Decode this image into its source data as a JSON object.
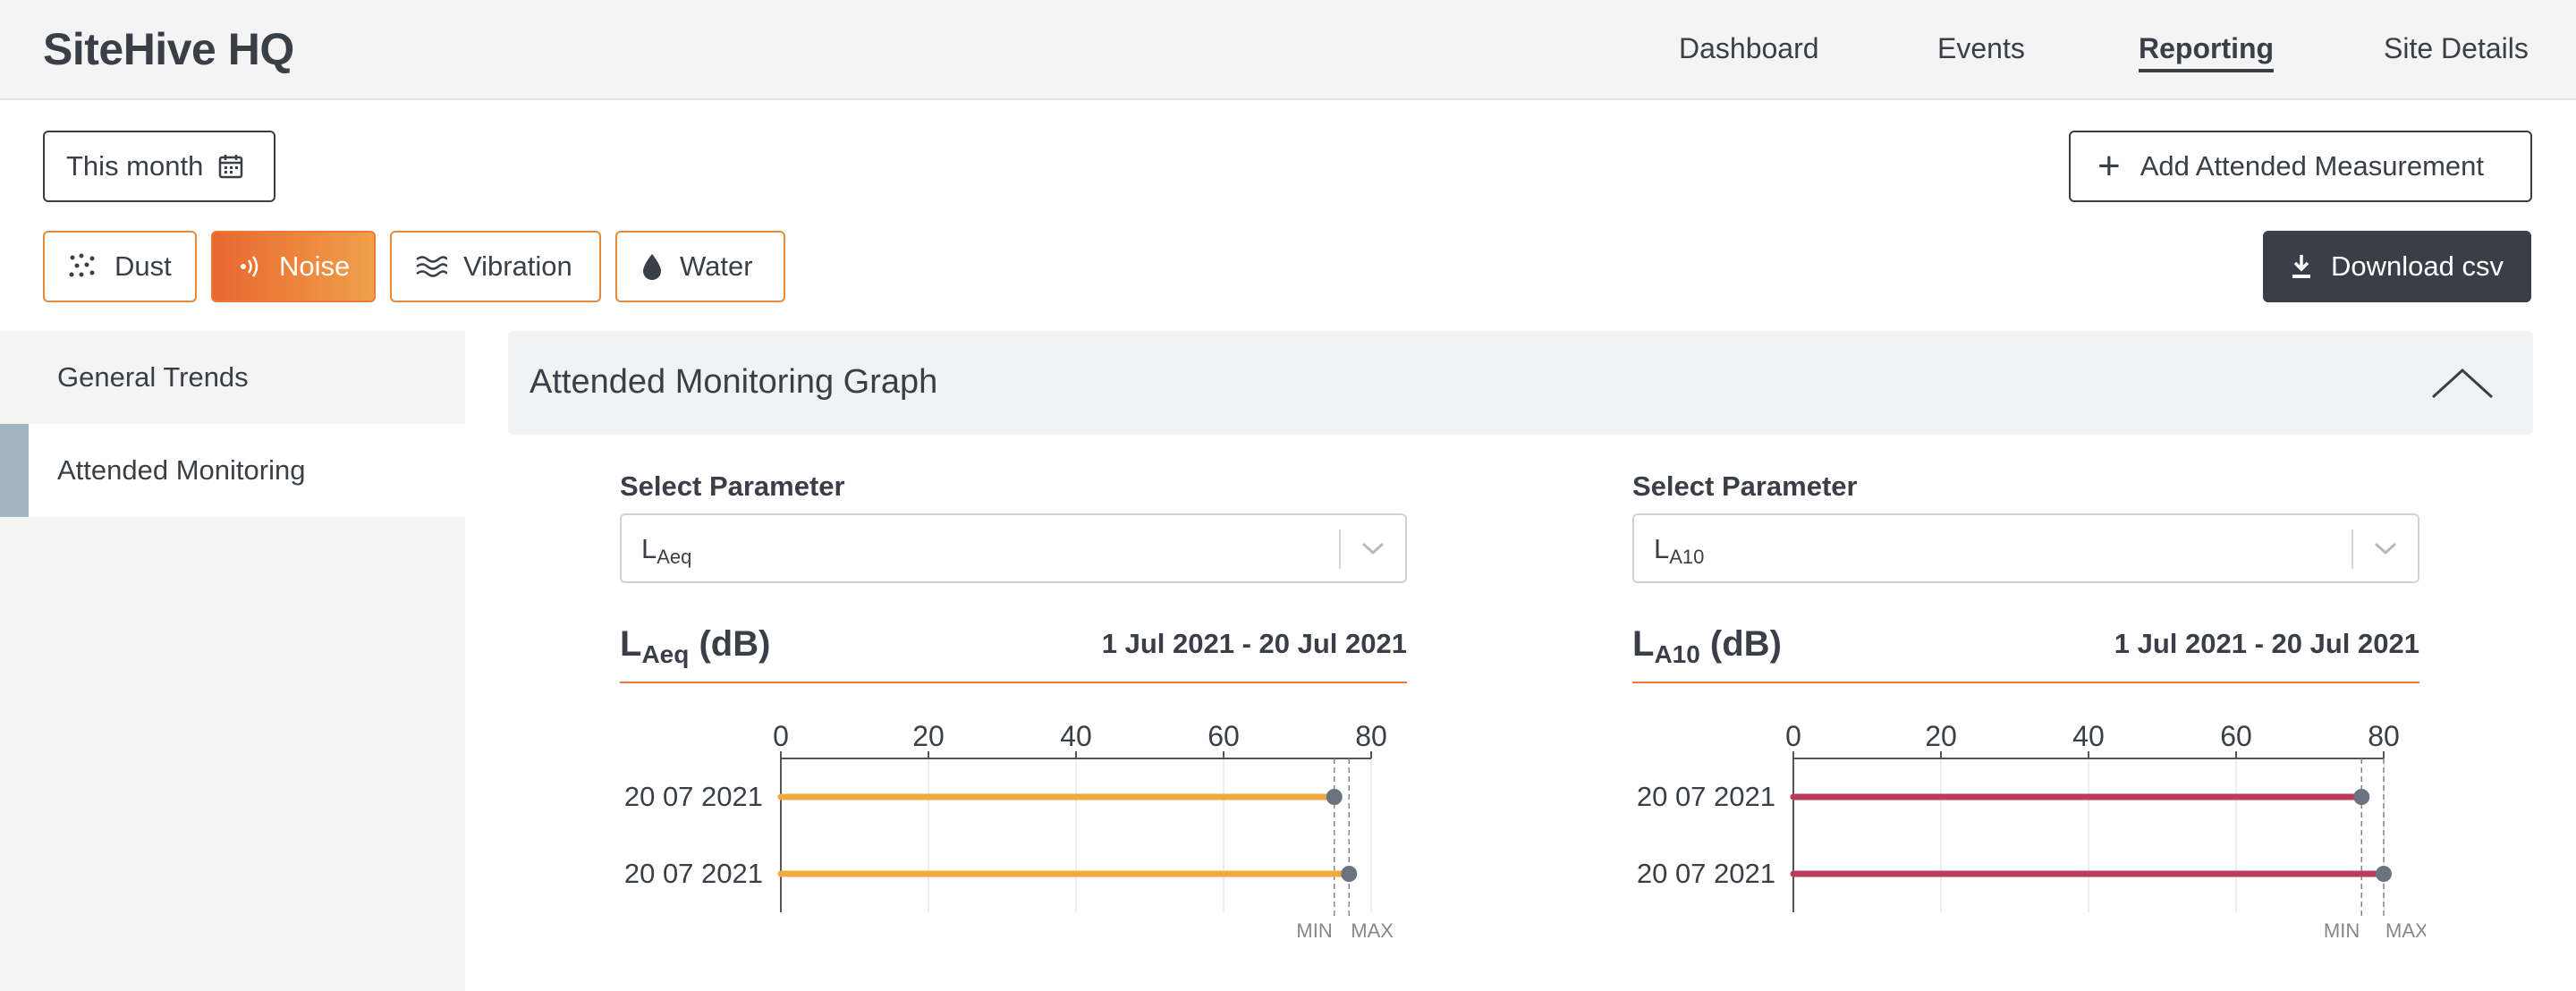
{
  "app": {
    "title": "SiteHive HQ"
  },
  "nav": {
    "items": [
      "Dashboard",
      "Events",
      "Reporting",
      "Site Details"
    ],
    "active": "Reporting"
  },
  "toolbar": {
    "date_range_label": "This month",
    "add_label": "Add Attended Measurement",
    "download_label": "Download csv"
  },
  "categories": [
    {
      "label": "Dust",
      "icon": "dust-icon",
      "active": false
    },
    {
      "label": "Noise",
      "icon": "noise-icon",
      "active": true
    },
    {
      "label": "Vibration",
      "icon": "vibration-icon",
      "active": false
    },
    {
      "label": "Water",
      "icon": "water-drop-icon",
      "active": false
    }
  ],
  "sidebar": {
    "items": [
      {
        "label": "General Trends",
        "active": false
      },
      {
        "label": "Attended Monitoring",
        "active": true
      }
    ]
  },
  "panel": {
    "title": "Attended Monitoring Graph"
  },
  "colors": {
    "accent": "#ea7a36",
    "dark": "#3a3f47",
    "laeq_bar": "#f2aa3c",
    "la10_bar": "#bd3a5a",
    "marker": "#6b7280",
    "sidebar_active": "#a3b4c1"
  },
  "left": {
    "param_label": "Select Parameter",
    "param_main": "L",
    "param_sub": "Aeq",
    "chart_title_main": "L",
    "chart_title_sub": "Aeq",
    "chart_title_unit": " (dB)",
    "date_range": "1 Jul 2021 - 20 Jul 2021"
  },
  "right": {
    "param_label": "Select Parameter",
    "param_main": "L",
    "param_sub": "A10",
    "chart_title_main": "L",
    "chart_title_sub": "A10",
    "chart_title_unit": " (dB)",
    "date_range": "1 Jul 2021 - 20 Jul 2021"
  },
  "chart_data": [
    {
      "type": "bar",
      "orientation": "horizontal",
      "title": "LAeq (dB)",
      "xlim": [
        0,
        80
      ],
      "xticks": [
        0,
        20,
        40,
        60,
        80
      ],
      "categories": [
        "20 07 2021",
        "20 07 2021"
      ],
      "values": [
        75,
        77
      ],
      "reference_labels": [
        "MIN",
        "MAX"
      ],
      "color": "#f2aa3c"
    },
    {
      "type": "bar",
      "orientation": "horizontal",
      "title": "LA10 (dB)",
      "xlim": [
        0,
        80
      ],
      "xticks": [
        0,
        20,
        40,
        60,
        80
      ],
      "categories": [
        "20 07 2021",
        "20 07 2021"
      ],
      "values": [
        77,
        80
      ],
      "reference_labels": [
        "MIN",
        "MAX"
      ],
      "color": "#bd3a5a"
    }
  ]
}
